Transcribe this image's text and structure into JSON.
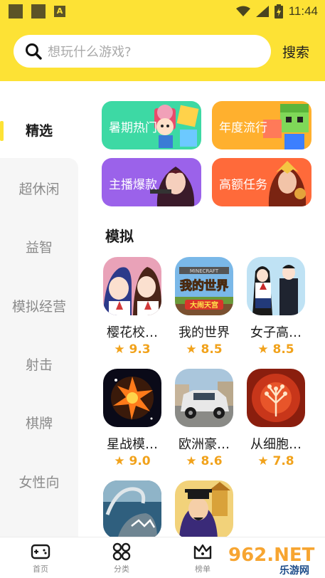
{
  "status_bar": {
    "time": "11:44",
    "app_badge": "A"
  },
  "search": {
    "placeholder": "想玩什么游戏?",
    "button_label": "搜索"
  },
  "sidebar": {
    "items": [
      {
        "label": "精选",
        "active": true
      },
      {
        "label": "超休闲",
        "active": false
      },
      {
        "label": "益智",
        "active": false
      },
      {
        "label": "模拟经营",
        "active": false
      },
      {
        "label": "射击",
        "active": false
      },
      {
        "label": "棋牌",
        "active": false
      },
      {
        "label": "女性向",
        "active": false
      }
    ]
  },
  "banners": [
    {
      "label": "暑期热门",
      "color": "#3dd9a4"
    },
    {
      "label": "年度流行",
      "color": "#ffb02e"
    },
    {
      "label": "主播爆款",
      "color": "#9b62ea"
    },
    {
      "label": "高额任务",
      "color": "#ff6a3a"
    }
  ],
  "section": {
    "title": "模拟"
  },
  "games": [
    {
      "name": "樱花校…",
      "rating": "9.3"
    },
    {
      "name": "我的世界",
      "rating": "8.5",
      "icon_text": "我的世界",
      "icon_sub": "大闹天宫",
      "icon_top": "MINECRAFT"
    },
    {
      "name": "女子高…",
      "rating": "8.5"
    },
    {
      "name": "星战模…",
      "rating": "9.0"
    },
    {
      "name": "欧洲豪…",
      "rating": "8.6"
    },
    {
      "name": "从细胞…",
      "rating": "7.8"
    },
    {
      "name": "",
      "rating": ""
    },
    {
      "name": "",
      "rating": ""
    }
  ],
  "bottom_nav": {
    "items": [
      {
        "label": "首页"
      },
      {
        "label": "分类"
      },
      {
        "label": "榜单"
      }
    ]
  },
  "watermark": {
    "text": "962.NET",
    "sub": "乐游网"
  },
  "colors": {
    "brand_yellow": "#fde235",
    "rating_orange": "#f1a21b"
  }
}
